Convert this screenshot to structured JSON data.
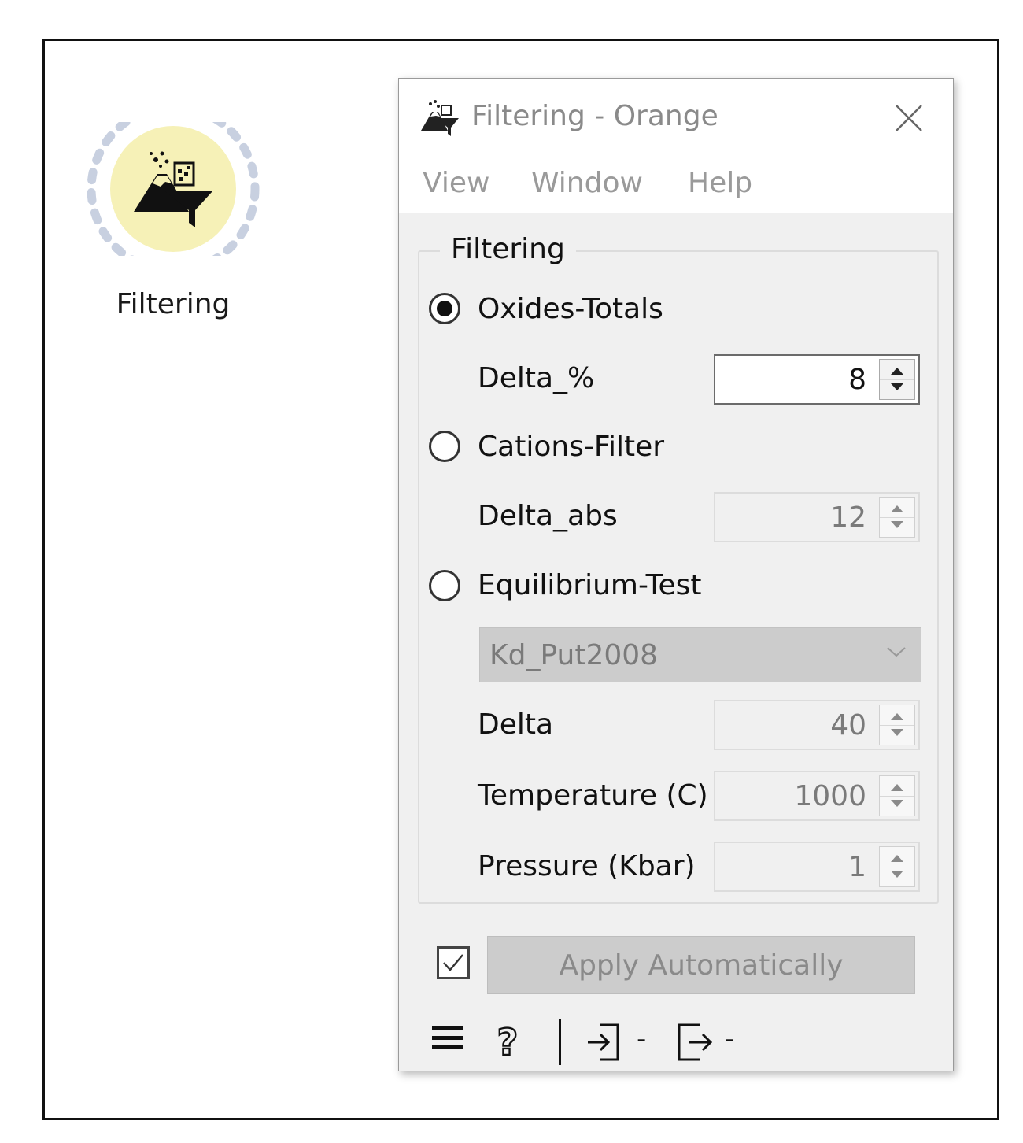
{
  "canvas": {
    "node_label": "Filtering"
  },
  "window": {
    "title": "Filtering - Orange",
    "menu": [
      "View",
      "Window",
      "Help"
    ]
  },
  "filtering": {
    "group_title": "Filtering",
    "options": [
      {
        "label": "Oxides-Totals",
        "checked": true
      },
      {
        "label": "Cations-Filter",
        "checked": false
      },
      {
        "label": "Equilibrium-Test",
        "checked": false
      }
    ],
    "delta_percent": {
      "label": "Delta_%",
      "value": "8"
    },
    "delta_abs": {
      "label": "Delta_abs",
      "value": "12"
    },
    "model_select": {
      "value": "Kd_Put2008"
    },
    "delta": {
      "label": "Delta",
      "value": "40"
    },
    "temperature": {
      "label": "Temperature (C)",
      "value": "1000"
    },
    "pressure": {
      "label": "Pressure (Kbar)",
      "value": "1"
    }
  },
  "footer": {
    "apply_auto_checked": true,
    "apply_label": "Apply Automatically",
    "input_status": "-",
    "output_status": "-"
  },
  "colors": {
    "node_fill": "#f6f1b7",
    "node_ring": "#c8d0e0",
    "window_bg": "#f0f0f0",
    "disabled_text": "#8a8a8a"
  },
  "icons": [
    "filtering-widget-icon",
    "close-icon",
    "radio-icon",
    "spin-up-icon",
    "spin-down-icon",
    "chevron-down-icon",
    "checkbox-check-icon",
    "hamburger-menu-icon",
    "help-icon",
    "input-icon",
    "output-icon"
  ]
}
